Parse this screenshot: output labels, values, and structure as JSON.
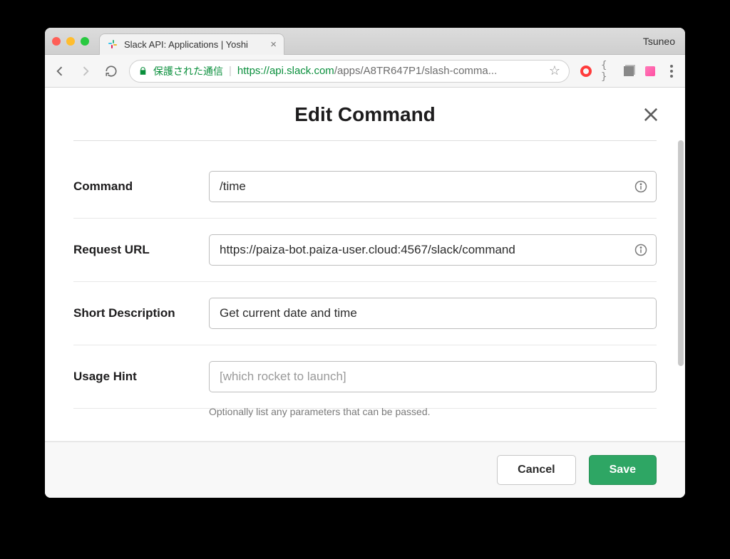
{
  "browser": {
    "tab_title": "Slack API: Applications | Yoshi",
    "profile_name": "Tsuneo",
    "secure_label": "保護された通信",
    "url_prefix": "https://",
    "url_host": "api.slack.com",
    "url_path": "/apps/A8TR647P1/slash-comma..."
  },
  "modal": {
    "title": "Edit Command",
    "fields": {
      "command": {
        "label": "Command",
        "value": "/time"
      },
      "request_url": {
        "label": "Request URL",
        "value": "https://paiza-bot.paiza-user.cloud:4567/slack/command"
      },
      "short_desc": {
        "label": "Short Description",
        "value": "Get current date and time"
      },
      "usage_hint": {
        "label": "Usage Hint",
        "value": "",
        "placeholder": "[which rocket to launch]",
        "helper": "Optionally list any parameters that can be passed."
      }
    },
    "buttons": {
      "cancel": "Cancel",
      "save": "Save"
    }
  }
}
